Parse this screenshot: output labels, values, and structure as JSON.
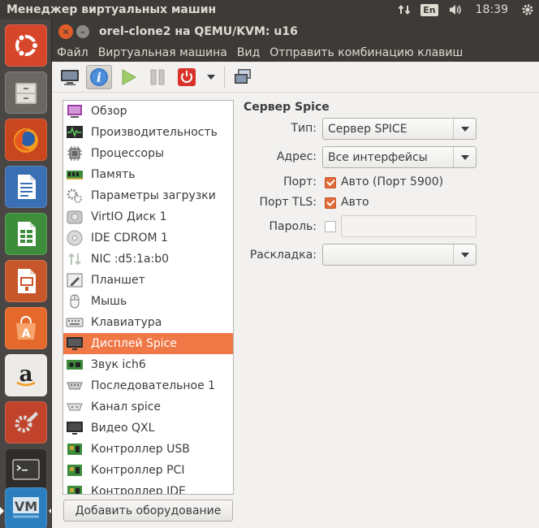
{
  "top_panel": {
    "title": "Менеджер виртуальных машин",
    "lang": "En",
    "clock": "18:39"
  },
  "window": {
    "title": "orel-clone2 на QEMU/KVM: u16",
    "close_glyph": "✕",
    "min_glyph": "–"
  },
  "menu": [
    "Файл",
    "Виртуальная машина",
    "Вид",
    "Отправить комбинацию клавиш"
  ],
  "devices": [
    {
      "label": "Обзор",
      "icon": "overview-icon"
    },
    {
      "label": "Производительность",
      "icon": "performance-icon"
    },
    {
      "label": "Процессоры",
      "icon": "cpu-icon"
    },
    {
      "label": "Память",
      "icon": "memory-icon"
    },
    {
      "label": "Параметры загрузки",
      "icon": "boot-options-icon"
    },
    {
      "label": "VirtIO Диск 1",
      "icon": "disk-icon"
    },
    {
      "label": "IDE CDROM 1",
      "icon": "cdrom-icon"
    },
    {
      "label": "NIC :d5:1a:b0",
      "icon": "network-icon"
    },
    {
      "label": "Планшет",
      "icon": "tablet-icon"
    },
    {
      "label": "Мышь",
      "icon": "mouse-icon"
    },
    {
      "label": "Клавиатура",
      "icon": "keyboard-icon"
    },
    {
      "label": "Дисплей Spice",
      "icon": "display-icon",
      "selected": true
    },
    {
      "label": "Звук ich6",
      "icon": "sound-card-icon"
    },
    {
      "label": "Последовательное 1",
      "icon": "serial-icon"
    },
    {
      "label": "Канал spice",
      "icon": "channel-icon"
    },
    {
      "label": "Видео QXL",
      "icon": "video-icon"
    },
    {
      "label": "Контроллер USB",
      "icon": "controller-icon"
    },
    {
      "label": "Контроллер PCI",
      "icon": "controller-icon"
    },
    {
      "label": "Контроллер IDE",
      "icon": "controller-icon"
    }
  ],
  "add_hardware_label": "Добавить оборудование",
  "details": {
    "section_title": "Сервер Spice",
    "type_label": "Тип:",
    "type_value": "Сервер SPICE",
    "address_label": "Адрес:",
    "address_value": "Все интерфейсы",
    "port_label": "Порт:",
    "port_auto": "Авто (Порт 5900)",
    "port_auto_checked": true,
    "tls_label": "Порт TLS:",
    "tls_auto": "Авто",
    "tls_auto_checked": true,
    "password_label": "Пароль:",
    "password_checked": false,
    "password_value": "",
    "keymap_label": "Раскладка:",
    "keymap_value": ""
  },
  "colors": {
    "selection": "#f07746",
    "panel": "#3c3b37",
    "window_bg": "#f2f1f0",
    "checkbox": "#e26b3a"
  }
}
